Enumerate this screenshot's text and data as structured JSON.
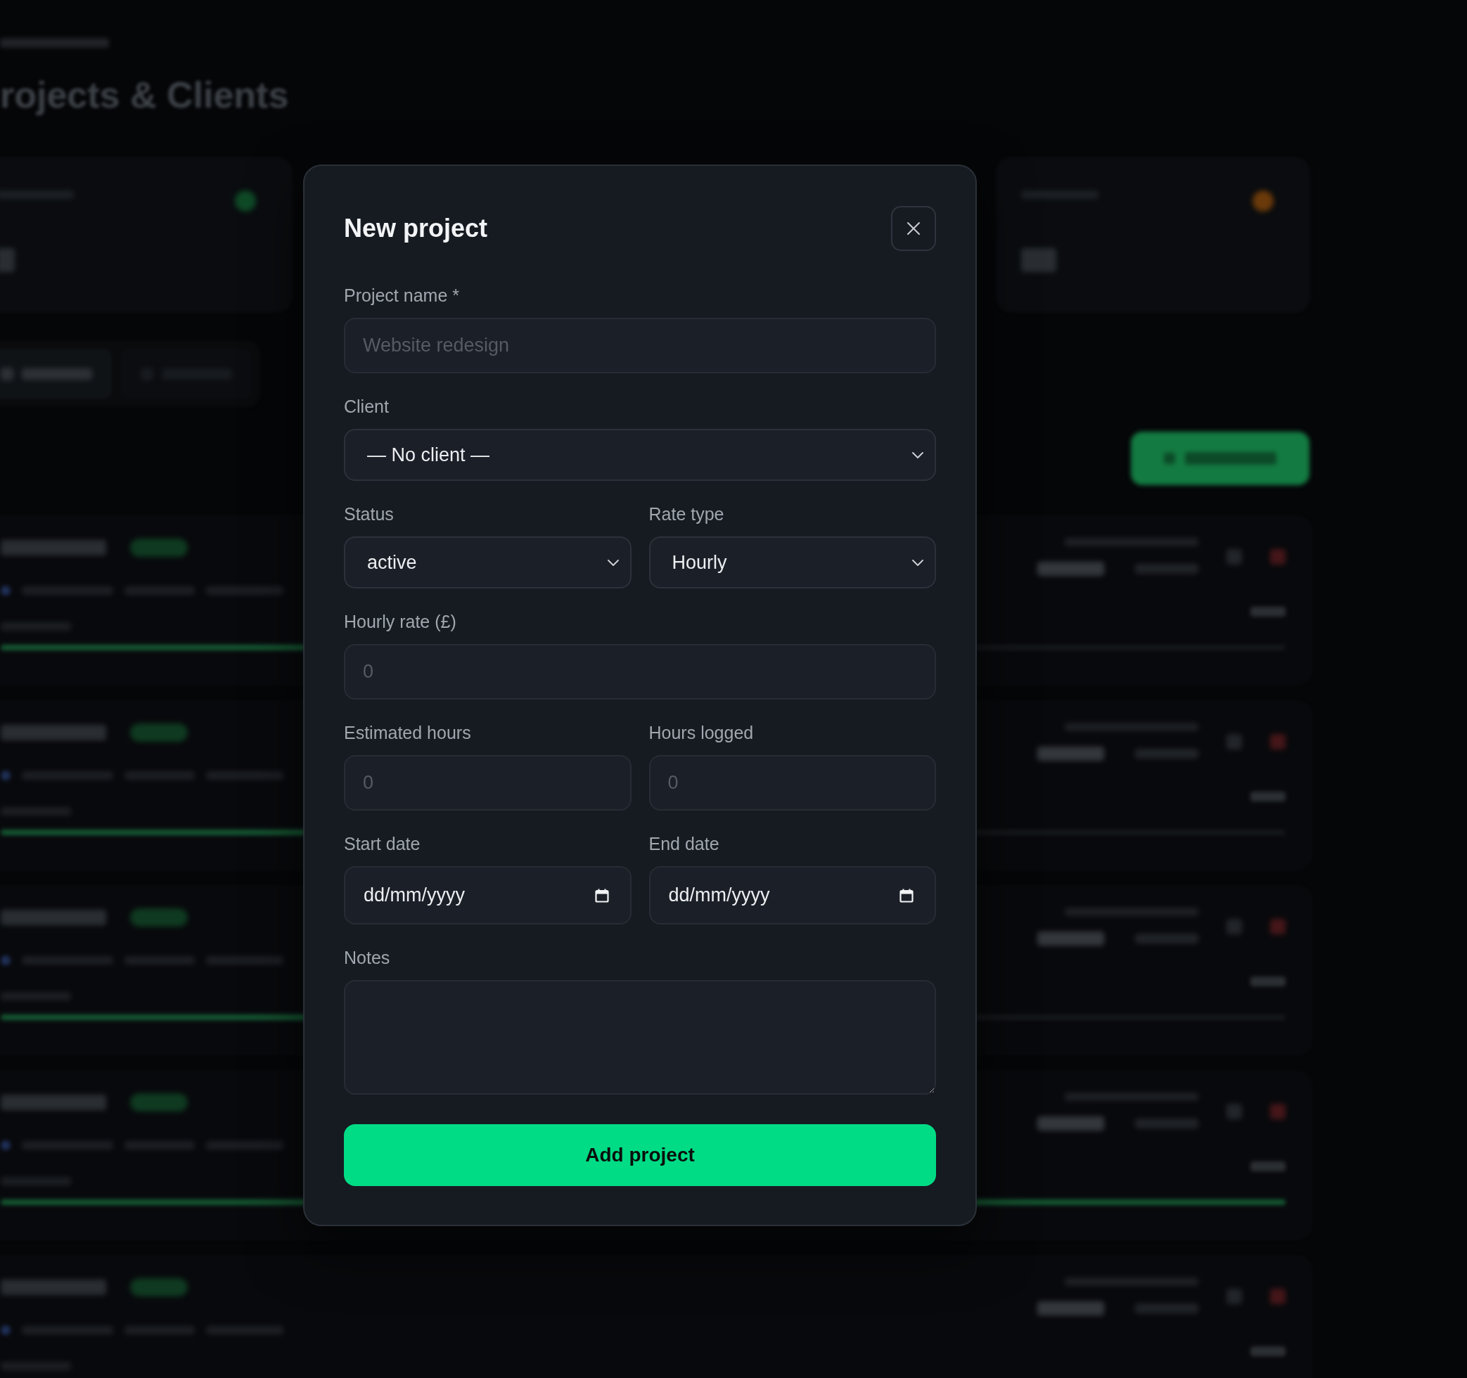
{
  "backdrop": {
    "title": "rojects & Clients",
    "stat_cards": [
      {
        "color": "#0f4a27"
      },
      {
        "color": "#6b3a0a"
      }
    ],
    "tabs": [
      {
        "selected": true
      },
      {
        "selected": false
      }
    ],
    "projects": [
      {
        "badge": true,
        "level": 0.5
      },
      {
        "badge": true,
        "level": 0.5
      },
      {
        "badge": true,
        "level": 0.5
      },
      {
        "badge": true,
        "level": 1
      },
      {
        "badge": true
      }
    ]
  },
  "dialog": {
    "title": "New project",
    "rows": [
      {
        "fields": [
          {
            "kind": "text",
            "label": "Project name *",
            "placeholder": "Website redesign"
          }
        ]
      },
      {
        "fields": [
          {
            "kind": "select",
            "label": "Client",
            "value": "— No client —"
          }
        ]
      },
      {
        "fields": [
          {
            "kind": "select",
            "label": "Status",
            "value": "active"
          },
          {
            "kind": "select",
            "label": "Rate type",
            "value": "Hourly"
          }
        ]
      },
      {
        "fields": [
          {
            "kind": "text",
            "label": "Hourly rate (£)",
            "placeholder": "0"
          }
        ]
      },
      {
        "fields": [
          {
            "kind": "text",
            "label": "Estimated hours",
            "placeholder": "0"
          },
          {
            "kind": "text",
            "label": "Hours logged",
            "placeholder": "0"
          }
        ]
      },
      {
        "fields": [
          {
            "kind": "date",
            "label": "Start date",
            "value": "dd/mm/yyyy"
          },
          {
            "kind": "date",
            "label": "End date",
            "value": "dd/mm/yyyy"
          }
        ]
      },
      {
        "fields": [
          {
            "kind": "textarea",
            "label": "Notes"
          }
        ]
      }
    ],
    "submit": "Add project"
  }
}
